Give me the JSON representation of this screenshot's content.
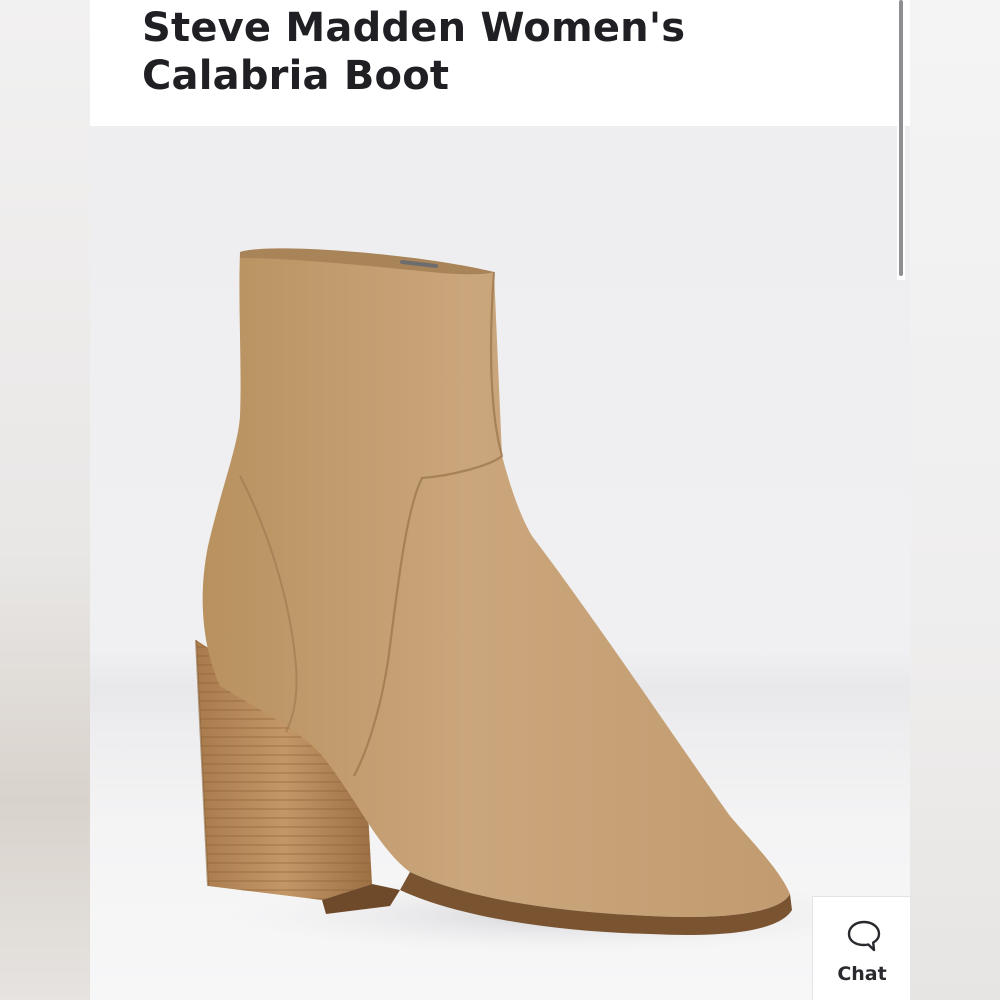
{
  "product": {
    "title": "Steve Madden Women's Calabria Boot",
    "image_icon": "ankle-boot-photo"
  },
  "chat": {
    "label": "Chat",
    "icon": "speech-bubble-icon"
  },
  "colors": {
    "title_text": "#1f1f24",
    "suede": "#c9a57c",
    "heel_wood": "#b98c5c",
    "scroll_thumb": "#8e8e93"
  }
}
